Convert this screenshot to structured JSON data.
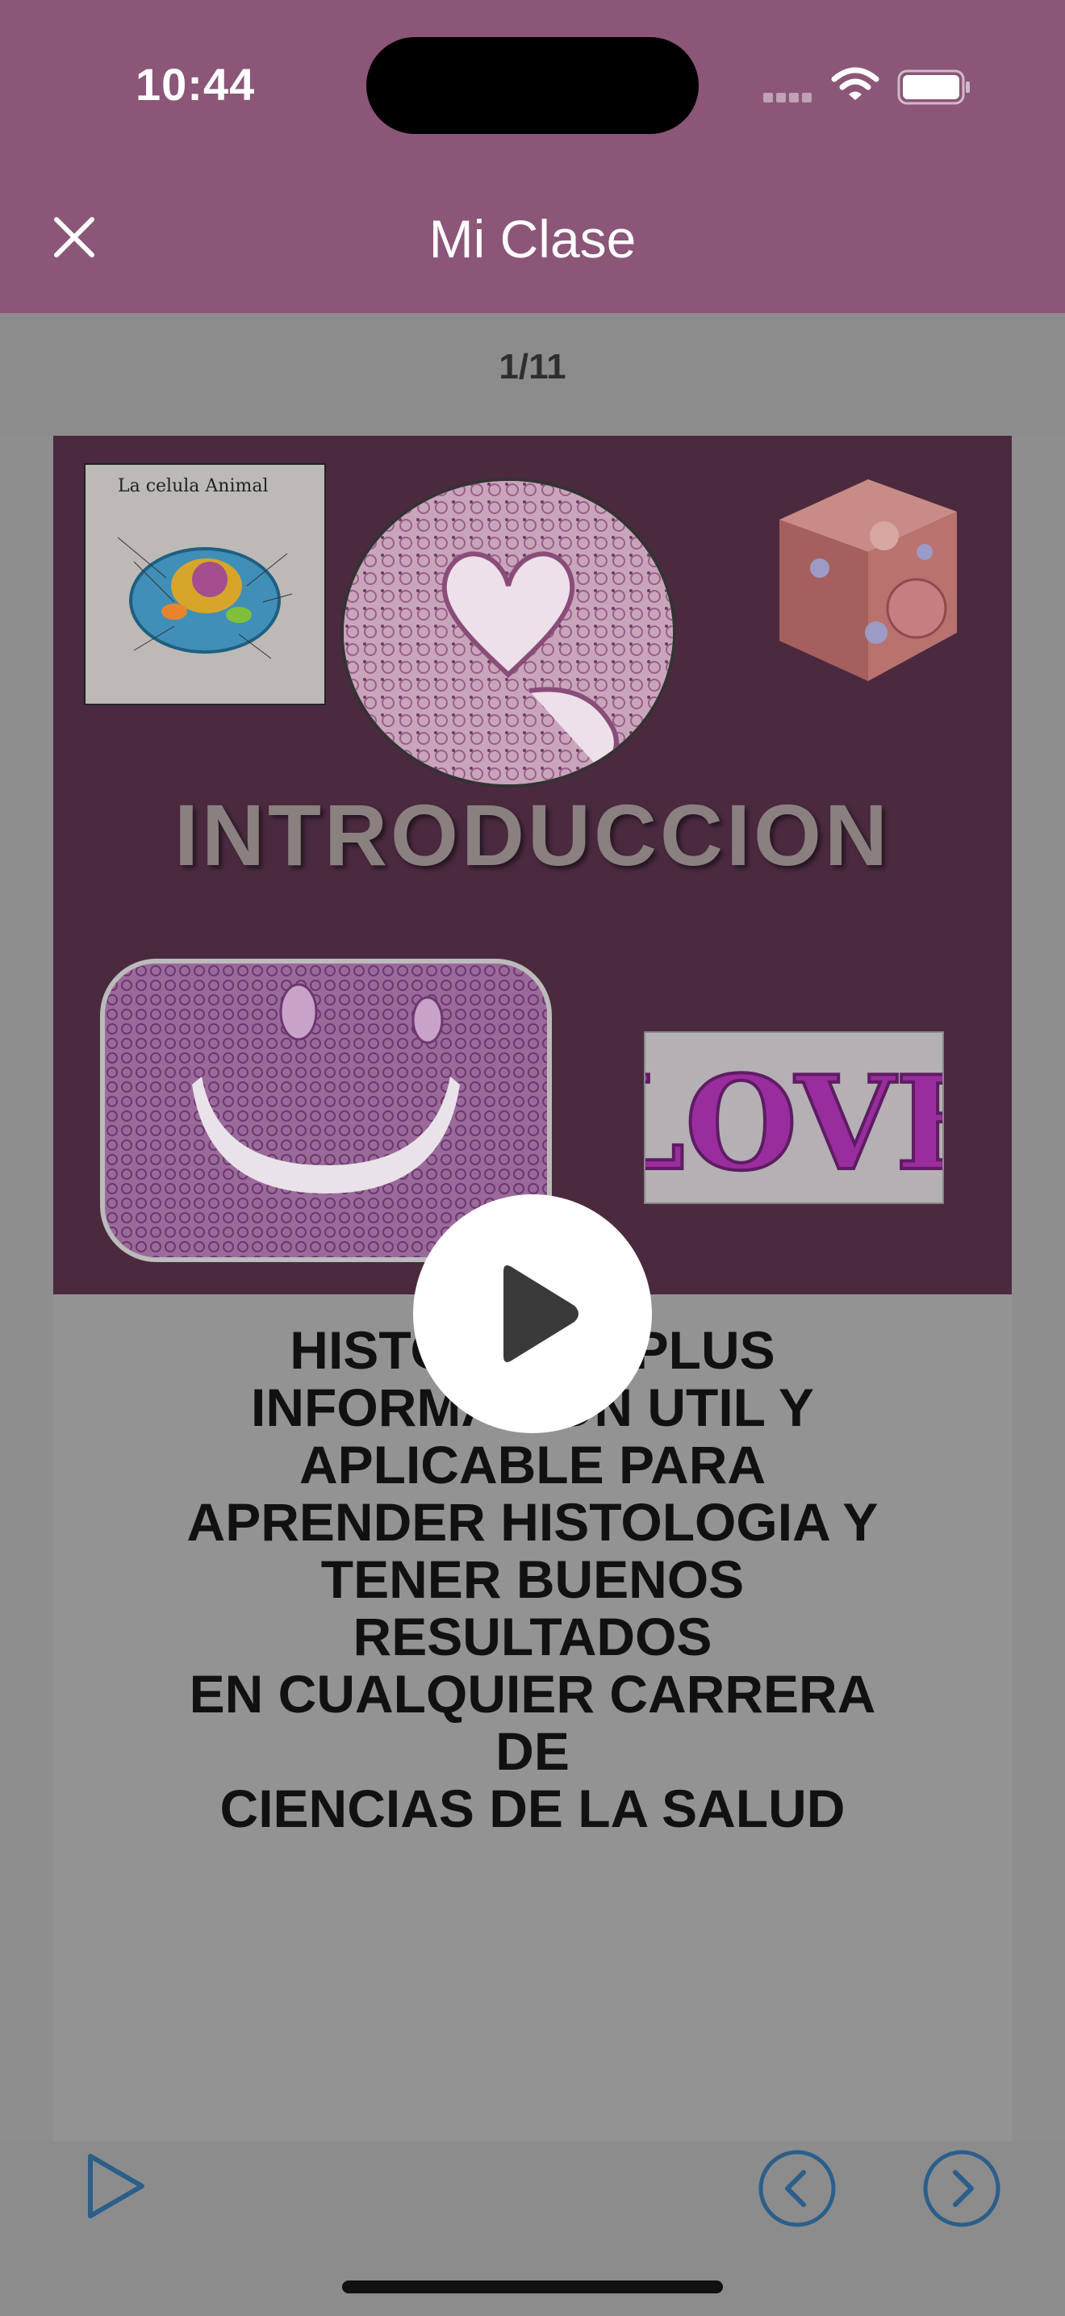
{
  "status_bar": {
    "time": "10:44"
  },
  "header": {
    "title": "Mi Clase"
  },
  "pager": {
    "indicator": "1/11"
  },
  "slide": {
    "intro_title": "INTRODUCCION",
    "cell_diagram_title": "La celula Animal",
    "love_image_text": "LOVE",
    "body_lines": [
      "HISTOLOGIA PLUS",
      "INFORMACION UTIL Y",
      "APLICABLE PARA",
      "APRENDER HISTOLOGIA Y",
      "TENER BUENOS",
      "RESULTADOS",
      "EN CUALQUIER CARRERA",
      "DE",
      "CIENCIAS DE LA SALUD"
    ]
  },
  "icons": {
    "close": "close-icon",
    "play_overlay": "play-icon",
    "toolbar_play": "play-outline-icon",
    "prev": "chevron-left-circle-icon",
    "next": "chevron-right-circle-icon"
  },
  "colors": {
    "header_bg": "#8b5677",
    "slide_bg": "#4b2a40",
    "accent_blue": "#2b5f8a"
  }
}
